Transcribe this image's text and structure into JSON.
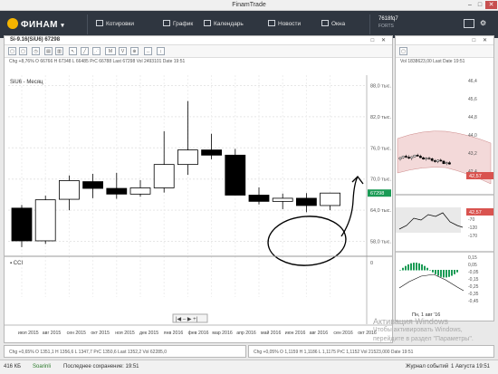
{
  "window": {
    "title": "FinamTrade"
  },
  "toolbar": {
    "logo": "ФИНАМ",
    "items": [
      "Котировки",
      "График",
      "Календарь",
      "Новости",
      "Окна"
    ],
    "account": "7618fq7",
    "account_sub": "FORTS"
  },
  "chart": {
    "panel_title": "Si-9.16(SiU6) 67298",
    "info": "Chg +8,76%   O 66766   H 67348   L 66485   PrC 66788   Last 67298   Vol 2493101   Date 19:51",
    "series_label": "SiU6 - Месяц",
    "indicator_label": "CCI",
    "nav": "|◀ – ▶ +|"
  },
  "chart_data": {
    "type": "candlestick",
    "x": [
      "июл 2015",
      "авг 2015",
      "сен 2015",
      "окт 2015",
      "ноя 2015",
      "дек 2015",
      "янв 2016",
      "фев 2016",
      "мар 2016",
      "апр 2016",
      "май 2016",
      "июн 2016",
      "июл 2016",
      "авг 2016"
    ],
    "ohlc": [
      [
        64400,
        65000,
        56900,
        58100
      ],
      [
        58100,
        66800,
        57500,
        66000
      ],
      [
        66100,
        70700,
        64000,
        69700
      ],
      [
        69500,
        71000,
        66300,
        68200
      ],
      [
        68200,
        71200,
        66200,
        67100
      ],
      [
        67100,
        69800,
        66600,
        68300
      ],
      [
        68300,
        79200,
        67400,
        72800
      ],
      [
        72800,
        85000,
        70800,
        75600
      ],
      [
        75600,
        78700,
        73800,
        74600
      ],
      [
        74600,
        75800,
        69100,
        66900
      ],
      [
        66900,
        68400,
        65100,
        65700
      ],
      [
        65700,
        67200,
        64200,
        66300
      ],
      [
        66300,
        67300,
        63600,
        64900
      ],
      [
        64900,
        67350,
        64000,
        67298
      ]
    ],
    "ylim": [
      56000,
      90000
    ],
    "y_ticks": [
      "88,0 тыс.",
      "82,0 тыс.",
      "76,0 тыс.",
      "70,0 тыс.",
      "64,0 тыс.",
      "58,0 тыс."
    ],
    "y_tick_values": [
      88000,
      82000,
      76000,
      70000,
      64000,
      58000
    ],
    "last_price": "67298",
    "x_ticks": [
      "июл 2015",
      "авг 2015",
      "сен 2015",
      "окт 2015",
      "ноя 2015",
      "дек 2015",
      "янв 2016",
      "фев 2016",
      "мар 2016",
      "апр 2016",
      "май 2016",
      "июн 2016",
      "авг 2016",
      "сен 2016",
      "окт 2016"
    ],
    "cci_ticks": [
      "0"
    ]
  },
  "right": {
    "info": "Vol 1838623,00   Last    Date 19:51",
    "price_ticks": [
      "46,4",
      "45,6",
      "44,8",
      "44,0",
      "43,2",
      "42,4"
    ],
    "price_badge": "42,57",
    "osc_ticks": [
      "-20",
      "-70",
      "-120",
      "-170"
    ],
    "osc_badge": "42,57",
    "macd_ticks": [
      "0,15",
      "0,05",
      "-0,05",
      "-0,15",
      "-0,25",
      "-0,35",
      "-0,45"
    ],
    "footer_date": "Пн, 1 авг '16"
  },
  "bottom": {
    "left_info": "Chg +0,65%   O 1351,1   H 1356,6   L 1347,7   PrC 1350,6   Last 1352,2   Vol 62285,0",
    "right_info": "Chg +0,05%   O 1,1159   H 1,1186   L 1,1175   PrC 1,1152   Vol 21523,000   Date 19:51"
  },
  "watermark": {
    "line1": "Активация Windows",
    "line2": "Чтобы активировать Windows,",
    "line3": "перейдите в раздел \"Параметры\"."
  },
  "status": {
    "left": "416 КБ",
    "connection": "Soarinli",
    "saved": "Последнее сохранение: 19:51",
    "journal": "Журнал событий",
    "datetime": "1 Августа 19:51"
  },
  "colors": {
    "toolbar": "#2f3640",
    "bull": "#ffffff",
    "bear": "#000000",
    "badge": "#d9534f",
    "badge_green": "#1a9b55"
  }
}
